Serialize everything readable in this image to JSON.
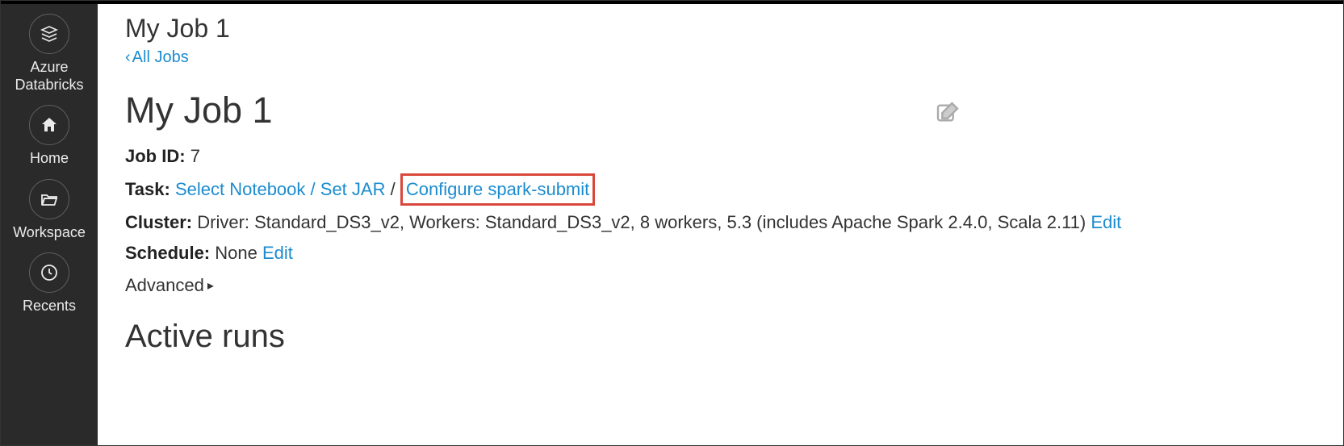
{
  "sidebar": {
    "brand": "Azure Databricks",
    "home": "Home",
    "workspace": "Workspace",
    "recents": "Recents"
  },
  "breadcrumb": {
    "title": "My Job 1",
    "back_label": "All Jobs"
  },
  "job": {
    "title": "My Job 1",
    "id_label": "Job ID:",
    "id_value": "7",
    "task_label": "Task:",
    "task_select_notebook": "Select Notebook",
    "task_set_jar": "Set JAR",
    "task_configure_spark_submit": "Configure spark-submit",
    "cluster_label": "Cluster:",
    "cluster_value": "Driver: Standard_DS3_v2, Workers: Standard_DS3_v2, 8 workers, 5.3 (includes Apache Spark 2.4.0, Scala 2.11)",
    "cluster_edit": "Edit",
    "schedule_label": "Schedule:",
    "schedule_value": "None",
    "schedule_edit": "Edit",
    "advanced_label": "Advanced"
  },
  "sections": {
    "active_runs": "Active runs"
  }
}
